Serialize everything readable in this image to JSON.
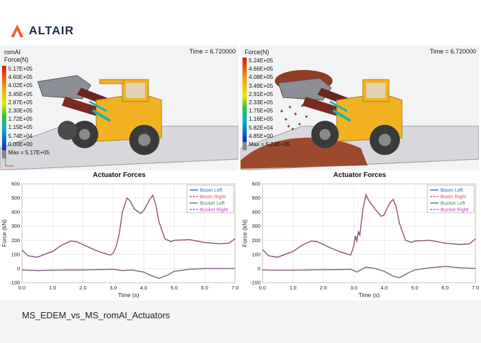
{
  "header": {
    "brand": "ALTAIR",
    "brand_color": "#f05a28"
  },
  "panels": [
    {
      "label_line1": "romAI",
      "label_line2": "Force(N)",
      "time": "Time = 6.720000",
      "legend_values": [
        "5.17E+05",
        "4.60E+05",
        "4.02E+05",
        "3.45E+05",
        "2.87E+05",
        "2.30E+05",
        "1.72E+05",
        "1.15E+05",
        "5.74E+04",
        "0.00E+00"
      ],
      "max_text": "Max = 5.17E+05"
    },
    {
      "label_line1": "Force(N)",
      "time": "Time = 6.720000",
      "legend_values": [
        "5.24E+05",
        "4.66E+05",
        "4.08E+05",
        "3.49E+05",
        "2.91E+05",
        "2.33E+05",
        "1.75E+05",
        "1.16E+05",
        "5.82E+04",
        "4.85E+00"
      ],
      "max_text": "Max = 5.24E+05"
    }
  ],
  "chart_data": [
    {
      "type": "line",
      "title": "Actuator Forces",
      "xlabel": "Time (s)",
      "ylabel": "Force (kN)",
      "xlim": [
        0,
        7
      ],
      "ylim": [
        -100,
        600
      ],
      "xticks": [
        0.0,
        1.0,
        2.0,
        3.0,
        4.0,
        5.0,
        6.0,
        7.0
      ],
      "yticks": [
        -100,
        0,
        100,
        200,
        300,
        400,
        500,
        600
      ],
      "grid": true,
      "legend_position": "top-right",
      "series": [
        {
          "name": "Boom Left",
          "color": "#2b5fb4",
          "dash": "solid",
          "x": [
            0,
            0.2,
            0.5,
            0.8,
            1.0,
            1.3,
            1.6,
            1.8,
            2.0,
            2.3,
            2.6,
            2.9,
            3.0,
            3.1,
            3.2,
            3.3,
            3.45,
            3.55,
            3.7,
            3.9,
            4.0,
            4.1,
            4.2,
            4.3,
            4.4,
            4.5,
            4.7,
            4.9,
            5.0,
            5.5,
            6.0,
            6.5,
            6.8,
            7.0
          ],
          "y": [
            130,
            90,
            80,
            105,
            120,
            165,
            195,
            190,
            170,
            140,
            115,
            95,
            110,
            160,
            250,
            400,
            500,
            480,
            420,
            390,
            410,
            450,
            490,
            520,
            450,
            330,
            210,
            190,
            200,
            205,
            185,
            175,
            180,
            210
          ]
        },
        {
          "name": "Boom Right",
          "color": "#d9534f",
          "dash": "dash",
          "x": [
            0,
            0.2,
            0.5,
            0.8,
            1.0,
            1.3,
            1.6,
            1.8,
            2.0,
            2.3,
            2.6,
            2.9,
            3.0,
            3.1,
            3.2,
            3.3,
            3.45,
            3.55,
            3.7,
            3.9,
            4.0,
            4.1,
            4.2,
            4.3,
            4.4,
            4.5,
            4.7,
            4.9,
            5.0,
            5.5,
            6.0,
            6.5,
            6.8,
            7.0
          ],
          "y": [
            130,
            90,
            80,
            105,
            120,
            165,
            195,
            190,
            170,
            140,
            115,
            95,
            110,
            160,
            250,
            400,
            500,
            480,
            420,
            390,
            410,
            450,
            490,
            520,
            450,
            330,
            210,
            190,
            200,
            205,
            185,
            175,
            180,
            210
          ]
        },
        {
          "name": "Bucket Left",
          "color": "#3a8f3a",
          "dash": "solid",
          "x": [
            0,
            0.5,
            1.0,
            1.5,
            2.0,
            2.5,
            3.0,
            3.3,
            3.6,
            4.0,
            4.3,
            4.5,
            4.8,
            5.0,
            5.5,
            6.0,
            6.5,
            7.0
          ],
          "y": [
            -10,
            -15,
            -12,
            -10,
            -10,
            -8,
            -5,
            -15,
            -10,
            -25,
            -55,
            -70,
            -45,
            -20,
            -5,
            0,
            0,
            0
          ]
        },
        {
          "name": "Bucket Right",
          "color": "#c040c0",
          "dash": "dash",
          "x": [
            0,
            0.5,
            1.0,
            1.5,
            2.0,
            2.5,
            3.0,
            3.3,
            3.6,
            4.0,
            4.3,
            4.5,
            4.8,
            5.0,
            5.5,
            6.0,
            6.5,
            7.0
          ],
          "y": [
            -10,
            -15,
            -12,
            -10,
            -10,
            -8,
            -5,
            -15,
            -10,
            -25,
            -55,
            -70,
            -45,
            -20,
            -5,
            0,
            0,
            0
          ]
        }
      ]
    },
    {
      "type": "line",
      "title": "Actuator Forces",
      "xlabel": "Time (s)",
      "ylabel": "Force (kN)",
      "xlim": [
        0,
        7
      ],
      "ylim": [
        -100,
        600
      ],
      "xticks": [
        0.0,
        1.0,
        2.0,
        3.0,
        4.0,
        5.0,
        6.0,
        7.0
      ],
      "yticks": [
        -100,
        0,
        100,
        200,
        300,
        400,
        500,
        600
      ],
      "grid": true,
      "legend_position": "top-right",
      "series": [
        {
          "name": "Boom Left",
          "color": "#2b5fb4",
          "dash": "solid",
          "x": [
            0,
            0.2,
            0.5,
            0.8,
            1.0,
            1.3,
            1.6,
            1.8,
            2.0,
            2.3,
            2.6,
            2.9,
            3.0,
            3.05,
            3.1,
            3.15,
            3.2,
            3.3,
            3.4,
            3.5,
            3.7,
            3.9,
            4.0,
            4.1,
            4.2,
            4.3,
            4.4,
            4.5,
            4.7,
            4.9,
            5.0,
            5.5,
            6.0,
            6.5,
            6.8,
            7.0
          ],
          "y": [
            135,
            90,
            80,
            105,
            120,
            165,
            195,
            190,
            170,
            140,
            115,
            95,
            160,
            230,
            200,
            260,
            240,
            420,
            520,
            480,
            420,
            370,
            380,
            430,
            470,
            490,
            430,
            320,
            200,
            185,
            195,
            200,
            180,
            170,
            175,
            210
          ]
        },
        {
          "name": "Boom Right",
          "color": "#d9534f",
          "dash": "dash",
          "x": [
            0,
            0.2,
            0.5,
            0.8,
            1.0,
            1.3,
            1.6,
            1.8,
            2.0,
            2.3,
            2.6,
            2.9,
            3.0,
            3.05,
            3.1,
            3.15,
            3.2,
            3.3,
            3.4,
            3.5,
            3.7,
            3.9,
            4.0,
            4.1,
            4.2,
            4.3,
            4.4,
            4.5,
            4.7,
            4.9,
            5.0,
            5.5,
            6.0,
            6.5,
            6.8,
            7.0
          ],
          "y": [
            135,
            90,
            80,
            105,
            120,
            165,
            195,
            190,
            170,
            140,
            115,
            95,
            160,
            220,
            190,
            250,
            235,
            420,
            525,
            480,
            420,
            370,
            380,
            430,
            470,
            490,
            430,
            320,
            200,
            185,
            195,
            200,
            180,
            170,
            175,
            210
          ]
        },
        {
          "name": "Bucket Left",
          "color": "#3a8f3a",
          "dash": "solid",
          "x": [
            0,
            0.5,
            1.0,
            1.5,
            2.0,
            2.5,
            2.9,
            3.1,
            3.4,
            3.7,
            4.0,
            4.3,
            4.5,
            4.8,
            5.0,
            5.5,
            6.0,
            6.5,
            7.0
          ],
          "y": [
            -10,
            -12,
            -12,
            -10,
            -8,
            -8,
            -5,
            -25,
            10,
            0,
            -20,
            -55,
            -65,
            -30,
            -10,
            5,
            15,
            5,
            0
          ]
        },
        {
          "name": "Bucket Right",
          "color": "#c040c0",
          "dash": "dash",
          "x": [
            0,
            0.5,
            1.0,
            1.5,
            2.0,
            2.5,
            2.9,
            3.1,
            3.4,
            3.7,
            4.0,
            4.3,
            4.5,
            4.8,
            5.0,
            5.5,
            6.0,
            6.5,
            7.0
          ],
          "y": [
            -10,
            -12,
            -12,
            -10,
            -8,
            -8,
            -5,
            -25,
            10,
            0,
            -20,
            -55,
            -65,
            -30,
            -10,
            5,
            15,
            5,
            0
          ]
        }
      ]
    }
  ],
  "footer": {
    "title": "MS_EDEM_vs_MS_romAI_Actuators"
  }
}
